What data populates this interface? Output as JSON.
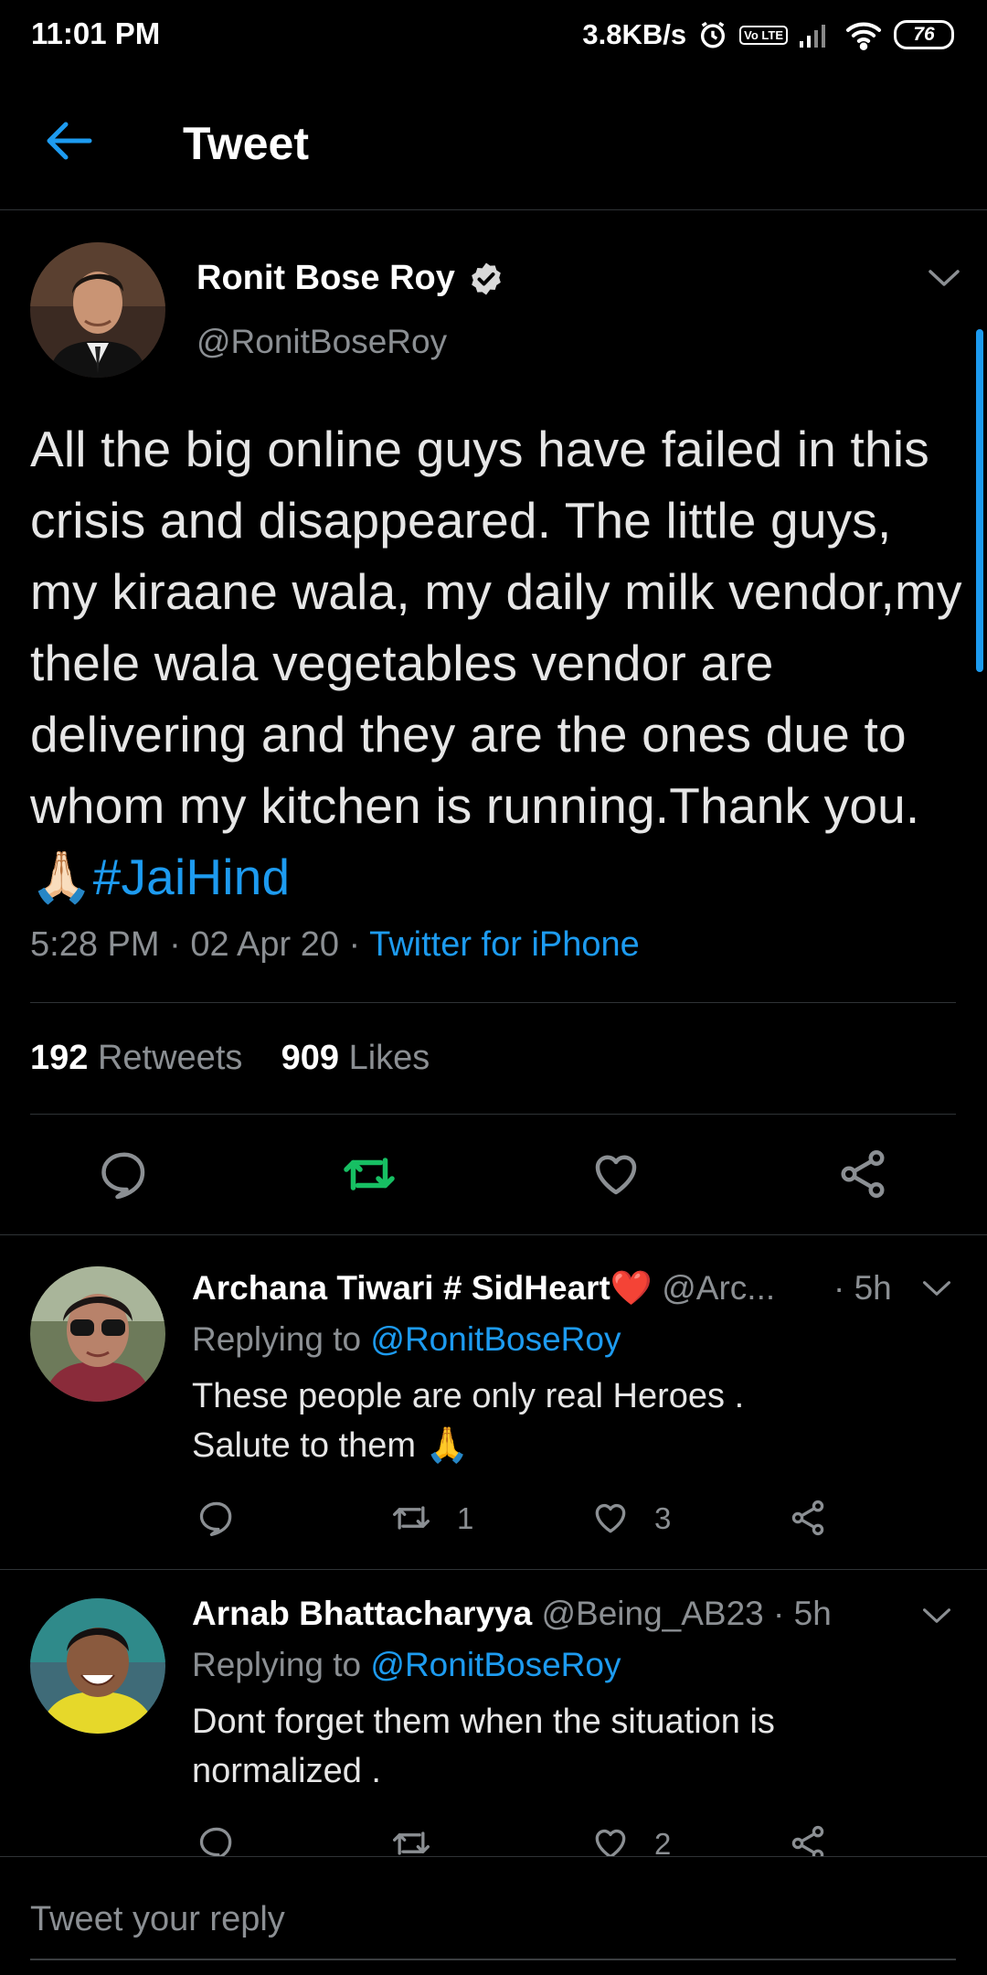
{
  "status_bar": {
    "time": "11:01 PM",
    "speed": "3.8KB/s",
    "volte": "Vo LTE",
    "battery": "76",
    "icons": [
      "alarm-icon",
      "signal-icon",
      "wifi-icon",
      "battery-icon"
    ]
  },
  "header": {
    "title": "Tweet",
    "back_icon": "arrow-left-icon"
  },
  "main_tweet": {
    "name": "Ronit Bose Roy",
    "handle": "@RonitBoseRoy",
    "text": "All the big online guys have failed in this crisis and disappeared. The little guys, my kiraane wala, my daily milk vendor,my thele wala vegetables vendor are delivering and they are the ones due to whom my kitchen is running.Thank you. 🙏🏻",
    "hashtag": "#JaiHind",
    "time": "5:28 PM",
    "date": "02 Apr 20",
    "source": "Twitter for iPhone",
    "retweets_count": "192",
    "retweets_label": "Retweets",
    "likes_count": "909",
    "likes_label": "Likes",
    "colors": {
      "accent": "#1d9bf0",
      "retweet": "#17bf63"
    }
  },
  "replies": [
    {
      "name": "Archana Tiwari # SidHeart❤️",
      "handle": "@Arc...",
      "time": "· 5h",
      "replying_label": "Replying to",
      "replying_to": "@RonitBoseRoy",
      "text_line1": "These people are only real Heroes .",
      "text_line2": "Salute to them 🙏",
      "retweets": "1",
      "likes": "3"
    },
    {
      "name": "Arnab Bhattacharyya",
      "handle": "@Being_AB23",
      "time": "· 5h",
      "replying_label": "Replying to",
      "replying_to": "@RonitBoseRoy",
      "text_line1": "Dont forget them when the situation is",
      "text_line2": "normalized  .",
      "retweets": "",
      "likes": "2"
    }
  ],
  "reply_bar": {
    "placeholder": "Tweet your reply"
  }
}
